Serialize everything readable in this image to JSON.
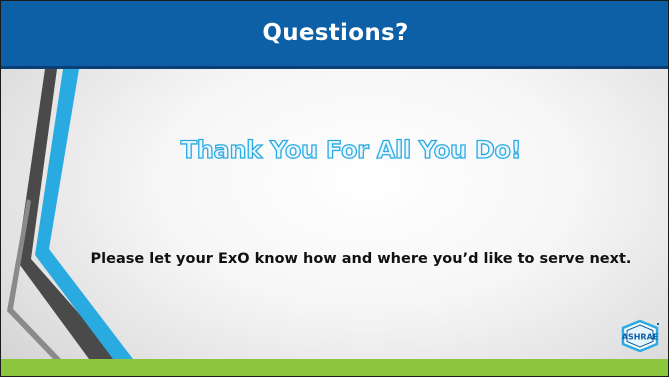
{
  "header": {
    "title": "Questions?"
  },
  "main": {
    "heading": "Thank You For All You Do!",
    "message": "Please let your ExO know how and where you’d like to serve next."
  },
  "logo": {
    "text": "ASHRAE"
  },
  "colors": {
    "header_bg": "#0d5fa6",
    "heading_outline": "#29abe2",
    "footer_bar": "#8cc63f",
    "stripe_dark": "#4a4a4a",
    "stripe_blue": "#29abe2"
  }
}
